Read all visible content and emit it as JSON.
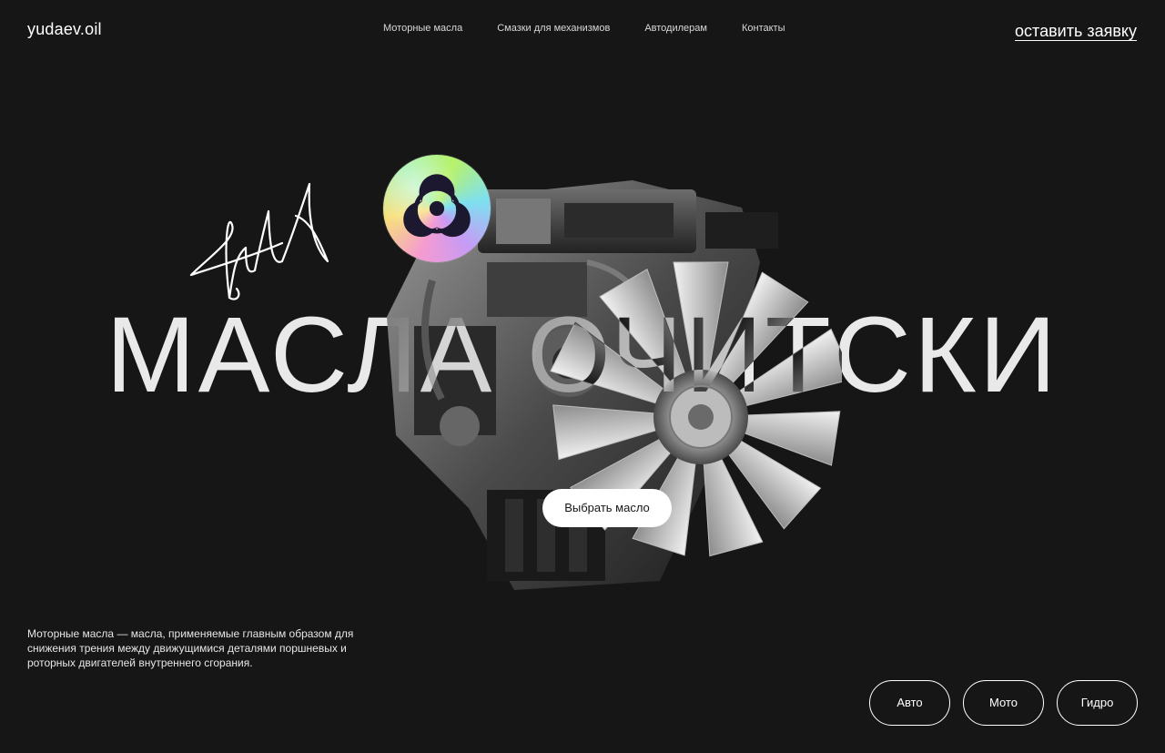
{
  "header": {
    "logo": "yudaev.oil",
    "nav": [
      {
        "label": "Моторные масла"
      },
      {
        "label": "Смазки для механизмов"
      },
      {
        "label": "Автодилерам"
      },
      {
        "label": "Контакты"
      }
    ],
    "cta": "оставить заявку"
  },
  "hero": {
    "title": "МАСЛА ОЧИТСКИ",
    "primary_button": "Выбрать масло",
    "badge_icon": "biohazard-icon",
    "image": "engine-image"
  },
  "description": "Моторные масла — масла, применяемые главным образом для снижения трения между движущимися деталями поршневых и роторных двигателей внутреннего сгорания.",
  "categories": [
    {
      "label": "Авто"
    },
    {
      "label": "Мото"
    },
    {
      "label": "Гидро"
    }
  ],
  "colors": {
    "background": "#161616",
    "text": "#ffffff",
    "button_bg": "#ffffff",
    "button_text": "#161616"
  }
}
